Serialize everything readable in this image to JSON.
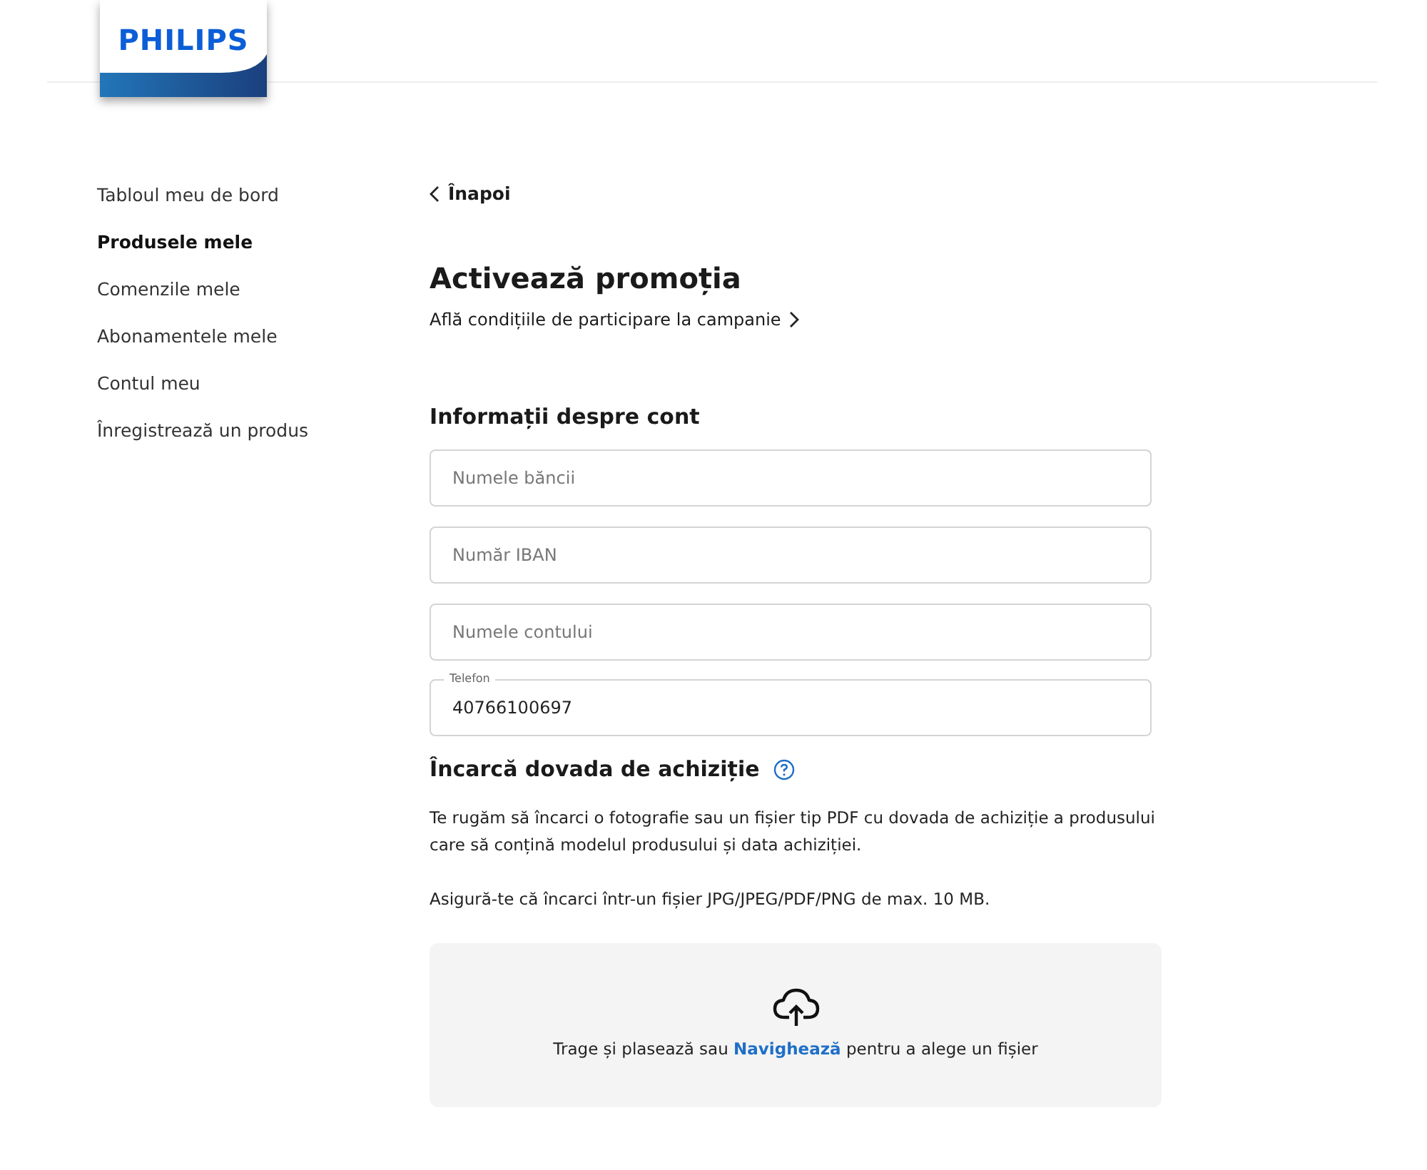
{
  "logo": {
    "text": "PHILIPS"
  },
  "sidebar": {
    "items": [
      {
        "label": "Tabloul meu de bord",
        "selected": false
      },
      {
        "label": "Produsele mele",
        "selected": true
      },
      {
        "label": "Comenzile mele",
        "selected": false
      },
      {
        "label": "Abonamentele mele",
        "selected": false
      },
      {
        "label": "Contul meu",
        "selected": false
      },
      {
        "label": "Înregistrează un produs",
        "selected": false
      }
    ]
  },
  "back_link": "Înapoi",
  "title": "Activează promoția",
  "terms_link": "Află condițiile de participare la campanie",
  "account_section": {
    "heading": "Informații despre cont",
    "fields": [
      {
        "kind": "placeholder",
        "placeholder": "Numele băncii"
      },
      {
        "kind": "placeholder",
        "placeholder": "Număr IBAN"
      },
      {
        "kind": "placeholder",
        "placeholder": "Numele contului"
      },
      {
        "kind": "labeled",
        "label": "Telefon",
        "value": "40766100697"
      }
    ]
  },
  "upload_section": {
    "heading": "Încarcă dovada de achiziție",
    "description": "Te rugăm să încarci o fotografie sau un fișier tip PDF cu dovada de achiziție a produsului care să conțină modelul produsului și data achiziției.",
    "note": "Asigură-te că încarci într-un fișier JPG/JPEG/PDF/PNG de max. 10 MB.",
    "dropzone": {
      "text_before": "Trage și plasează sau",
      "link": "Navighează",
      "text_after": "pentru a alege un fișier"
    }
  }
}
